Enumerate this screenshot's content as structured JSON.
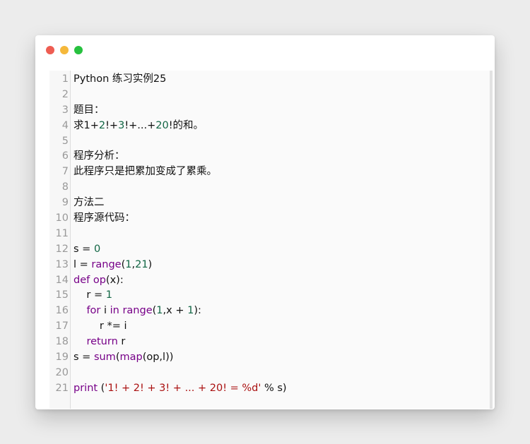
{
  "window": {
    "buttons": [
      {
        "name": "close-button",
        "color": "#ee5d52"
      },
      {
        "name": "minimize-button",
        "color": "#f5b83b"
      },
      {
        "name": "maximize-button",
        "color": "#27c13f"
      }
    ]
  },
  "editor": {
    "lines": [
      {
        "number": "1",
        "tokens": [
          {
            "text": "Python 练习实例25",
            "kind": "plain"
          }
        ]
      },
      {
        "number": "2",
        "tokens": []
      },
      {
        "number": "3",
        "tokens": [
          {
            "text": "题目：",
            "kind": "plain"
          }
        ]
      },
      {
        "number": "4",
        "tokens": [
          {
            "text": "求1+",
            "kind": "plain"
          },
          {
            "text": "2",
            "kind": "num"
          },
          {
            "text": "!+",
            "kind": "plain"
          },
          {
            "text": "3",
            "kind": "num"
          },
          {
            "text": "!+...+",
            "kind": "plain"
          },
          {
            "text": "20",
            "kind": "num"
          },
          {
            "text": "!的和。",
            "kind": "plain"
          }
        ]
      },
      {
        "number": "5",
        "tokens": []
      },
      {
        "number": "6",
        "tokens": [
          {
            "text": "程序分析：",
            "kind": "plain"
          }
        ]
      },
      {
        "number": "7",
        "tokens": [
          {
            "text": "此程序只是把累加变成了累乘。",
            "kind": "plain"
          }
        ]
      },
      {
        "number": "8",
        "tokens": []
      },
      {
        "number": "9",
        "tokens": [
          {
            "text": "方法二",
            "kind": "plain"
          }
        ]
      },
      {
        "number": "10",
        "tokens": [
          {
            "text": "程序源代码：",
            "kind": "plain"
          }
        ]
      },
      {
        "number": "11",
        "tokens": []
      },
      {
        "number": "12",
        "tokens": [
          {
            "text": "s = ",
            "kind": "plain"
          },
          {
            "text": "0",
            "kind": "num"
          }
        ]
      },
      {
        "number": "13",
        "tokens": [
          {
            "text": "l = ",
            "kind": "plain"
          },
          {
            "text": "range",
            "kind": "fn"
          },
          {
            "text": "(",
            "kind": "plain"
          },
          {
            "text": "1",
            "kind": "num"
          },
          {
            "text": ",",
            "kind": "plain"
          },
          {
            "text": "21",
            "kind": "num"
          },
          {
            "text": ")",
            "kind": "plain"
          }
        ]
      },
      {
        "number": "14",
        "tokens": [
          {
            "text": "def",
            "kind": "kw"
          },
          {
            "text": " ",
            "kind": "plain"
          },
          {
            "text": "op",
            "kind": "fn"
          },
          {
            "text": "(x):",
            "kind": "plain"
          }
        ]
      },
      {
        "number": "15",
        "tokens": [
          {
            "text": "    r = ",
            "kind": "plain"
          },
          {
            "text": "1",
            "kind": "num"
          }
        ]
      },
      {
        "number": "16",
        "tokens": [
          {
            "text": "    ",
            "kind": "plain"
          },
          {
            "text": "for",
            "kind": "kw"
          },
          {
            "text": " i ",
            "kind": "plain"
          },
          {
            "text": "in",
            "kind": "kw"
          },
          {
            "text": " ",
            "kind": "plain"
          },
          {
            "text": "range",
            "kind": "fn"
          },
          {
            "text": "(",
            "kind": "plain"
          },
          {
            "text": "1",
            "kind": "num"
          },
          {
            "text": ",x + ",
            "kind": "plain"
          },
          {
            "text": "1",
            "kind": "num"
          },
          {
            "text": "):",
            "kind": "plain"
          }
        ]
      },
      {
        "number": "17",
        "tokens": [
          {
            "text": "        r *= i",
            "kind": "plain"
          }
        ]
      },
      {
        "number": "18",
        "tokens": [
          {
            "text": "    ",
            "kind": "plain"
          },
          {
            "text": "return",
            "kind": "kw"
          },
          {
            "text": " r",
            "kind": "plain"
          }
        ]
      },
      {
        "number": "19",
        "tokens": [
          {
            "text": "s = ",
            "kind": "plain"
          },
          {
            "text": "sum",
            "kind": "fn"
          },
          {
            "text": "(",
            "kind": "plain"
          },
          {
            "text": "map",
            "kind": "fn"
          },
          {
            "text": "(op,l))",
            "kind": "plain"
          }
        ]
      },
      {
        "number": "20",
        "tokens": []
      },
      {
        "number": "21",
        "tokens": [
          {
            "text": "print",
            "kind": "kw"
          },
          {
            "text": " (",
            "kind": "plain"
          },
          {
            "text": "'1! + 2! + 3! + ... + 20! = %d'",
            "kind": "str"
          },
          {
            "text": " % s)",
            "kind": "plain"
          }
        ]
      }
    ]
  }
}
